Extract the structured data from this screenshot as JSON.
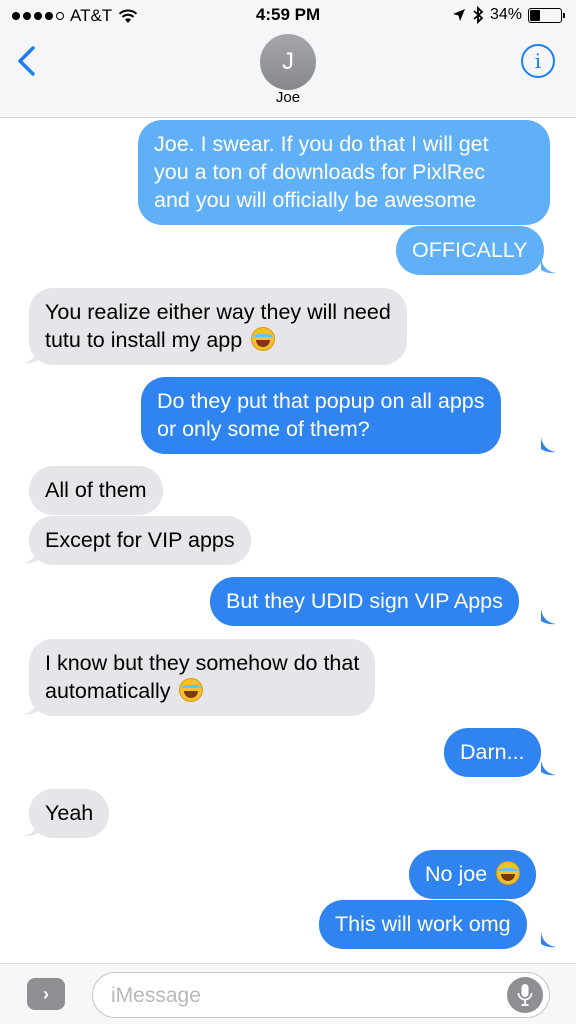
{
  "status_bar": {
    "carrier": "AT&T",
    "time": "4:59 PM",
    "battery_percent": "34%",
    "battery_level": 0.34,
    "signal_bars_filled": 4,
    "signal_bars_total": 5
  },
  "header": {
    "back_icon": "chevron-left-icon",
    "avatar_initial": "J",
    "contact_name": "Joe",
    "info_icon_glyph": "i"
  },
  "messages": [
    {
      "direction": "outgoing",
      "lines": [
        "Joe. I swear. If you do that I will get",
        "you a ton of downloads for PixlRec",
        "and you will officially be awesome"
      ]
    },
    {
      "direction": "outgoing",
      "lines": [
        "OFFICALLY"
      ]
    },
    {
      "direction": "incoming",
      "lines": [
        "You realize either way they will need",
        "tutu to install my app"
      ],
      "emoji": "face-with-tears-of-joy"
    },
    {
      "direction": "outgoing",
      "lines": [
        "Do they put that popup on all apps",
        "or only some of them?"
      ]
    },
    {
      "direction": "incoming",
      "lines": [
        "All of them"
      ]
    },
    {
      "direction": "incoming",
      "lines": [
        "Except for VIP apps"
      ]
    },
    {
      "direction": "outgoing",
      "lines": [
        "But they UDID sign VIP Apps"
      ]
    },
    {
      "direction": "incoming",
      "lines": [
        "I know but they somehow do that",
        "automatically"
      ],
      "emoji": "face-with-tears-of-joy"
    },
    {
      "direction": "outgoing",
      "lines": [
        "Darn..."
      ]
    },
    {
      "direction": "incoming",
      "lines": [
        "Yeah"
      ]
    },
    {
      "direction": "outgoing",
      "lines": [
        "No joe"
      ],
      "emoji": "face-with-tears-of-joy"
    },
    {
      "direction": "outgoing",
      "lines": [
        "This will work omg"
      ]
    }
  ],
  "input_bar": {
    "expand_glyph": "›",
    "placeholder": "iMessage",
    "value": "",
    "mic_icon": "microphone-icon"
  },
  "colors": {
    "outgoing_bubble": "#2f84ef",
    "outgoing_bubble_top": "#5fb0f7",
    "incoming_bubble": "#e5e5ea",
    "accent": "#1a7ef5"
  }
}
